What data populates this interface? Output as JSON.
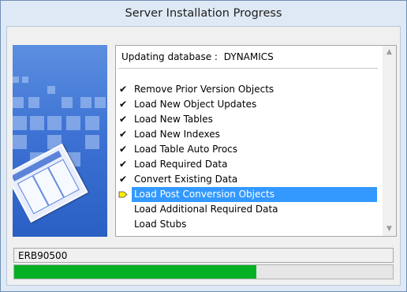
{
  "window": {
    "title": "Server Installation Progress"
  },
  "task": {
    "label": "Updating database :",
    "database": "DYNAMICS"
  },
  "steps": [
    {
      "label": "Remove Prior Version Objects",
      "status": "done"
    },
    {
      "label": "Load New Object Updates",
      "status": "done"
    },
    {
      "label": "Load New Tables",
      "status": "done"
    },
    {
      "label": "Load New Indexes",
      "status": "done"
    },
    {
      "label": "Load Table Auto Procs",
      "status": "done"
    },
    {
      "label": "Load Required Data",
      "status": "done"
    },
    {
      "label": "Convert Existing Data",
      "status": "done"
    },
    {
      "label": "Load Post Conversion Objects",
      "status": "current"
    },
    {
      "label": "Load Additional Required Data",
      "status": "pending"
    },
    {
      "label": "Load Stubs",
      "status": "pending"
    }
  ],
  "icons": {
    "done": "checkmark-icon",
    "current": "current-step-arrow-icon"
  },
  "status_text": "ERB90500",
  "progress": {
    "fraction": 0.64
  },
  "colors": {
    "progress_fill": "#06b025",
    "selection": "#3399ff",
    "current_arrow": "#ffee00"
  }
}
